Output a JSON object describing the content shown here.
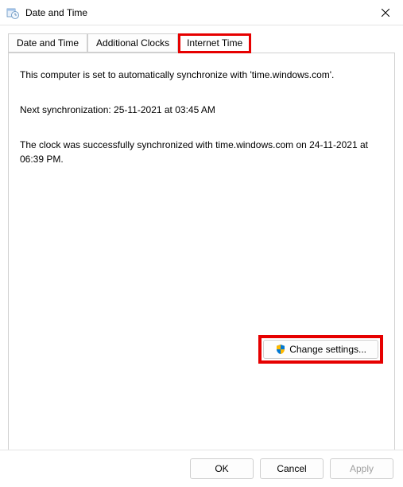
{
  "window": {
    "title": "Date and Time"
  },
  "tabs": {
    "tab1": "Date and Time",
    "tab2": "Additional Clocks",
    "tab3": "Internet Time"
  },
  "content": {
    "sync_info": "This computer is set to automatically synchronize with 'time.windows.com'.",
    "next_sync": "Next synchronization: 25-11-2021 at 03:45 AM",
    "last_sync": "The clock was successfully synchronized with time.windows.com on 24-11-2021 at 06:39 PM.",
    "change_settings": "Change settings..."
  },
  "footer": {
    "ok": "OK",
    "cancel": "Cancel",
    "apply": "Apply"
  }
}
